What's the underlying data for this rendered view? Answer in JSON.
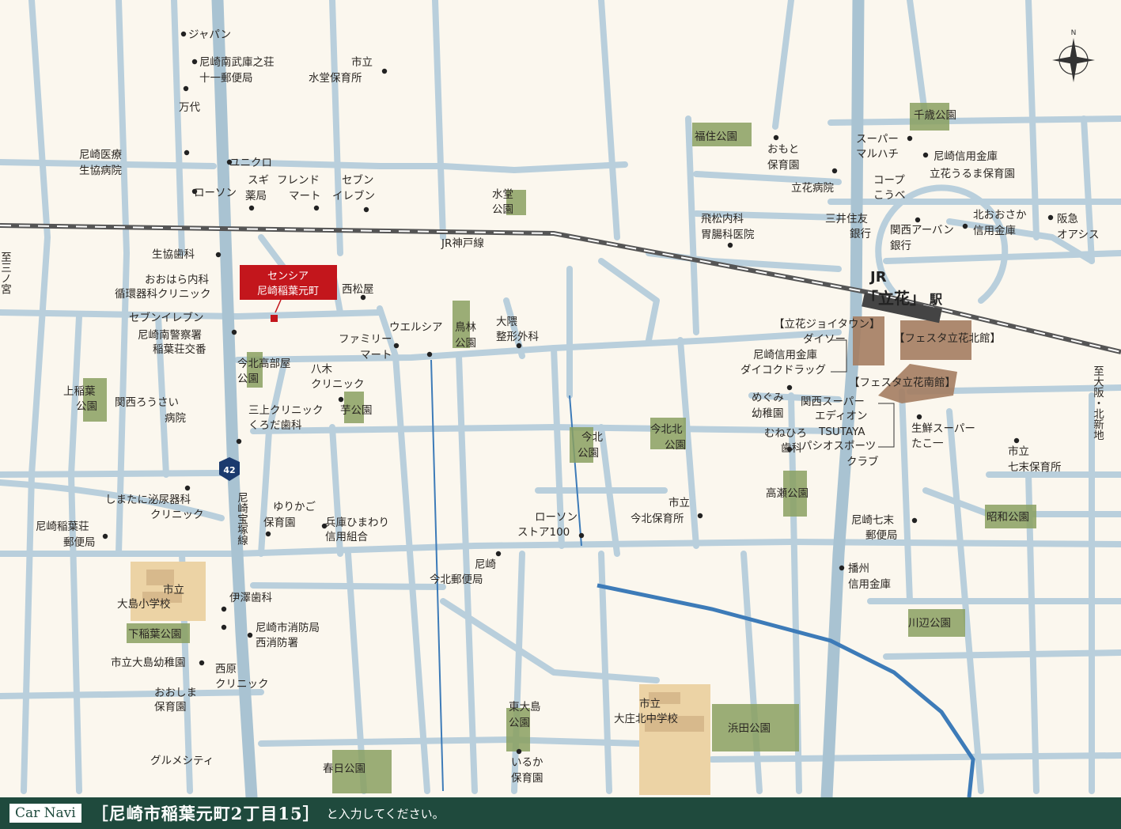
{
  "footer": {
    "carnavi": "Car Navi",
    "address": "［尼崎市稲葉元町2丁目15］",
    "instruction": "と入力してください。"
  },
  "property": {
    "line1": "センシア",
    "line2": "尼崎稲葉元町"
  },
  "station": {
    "jr": "JR",
    "name": "「立花」",
    "suffix": "駅"
  },
  "rail": {
    "line_name": "JR神戸線",
    "left_dest": "至三ノ宮",
    "right_dest": "至大阪・北新地"
  },
  "route": {
    "number": "42",
    "name": "尼崎宝塚線"
  },
  "compass": {
    "north": "N"
  },
  "colors": {
    "road": "#b9cfdc",
    "river": "#3d7bb8",
    "park": "#8aa060",
    "school": "#ecd3a5",
    "rail": "#555555",
    "property": "#c3161c",
    "footer": "#1f4a3d",
    "station": "#a57e62"
  },
  "facilities": [
    {
      "name": "ジャパン"
    },
    {
      "name": "尼崎南武庫之荘\n十一郵便局"
    },
    {
      "name": "市立\n水堂保育所"
    },
    {
      "name": "万代"
    },
    {
      "name": "尼崎医療\n生協病院"
    },
    {
      "name": "ユニクロ"
    },
    {
      "name": "スギ\n薬局"
    },
    {
      "name": "フレンド\nマート"
    },
    {
      "name": "セブン\nイレブン"
    },
    {
      "name": "ローソン"
    },
    {
      "name": "生協歯科"
    },
    {
      "name": "おおはら内科\n循環器科クリニック"
    },
    {
      "name": "セブンイレブン"
    },
    {
      "name": "尼崎南警察署\n稲葉荘交番"
    },
    {
      "name": "西松屋"
    },
    {
      "name": "ウエルシア"
    },
    {
      "name": "ファミリー\nマート"
    },
    {
      "name": "大隈\n整形外科"
    },
    {
      "name": "八木\nクリニック"
    },
    {
      "name": "三上クリニック\nくろだ歯科"
    },
    {
      "name": "関西ろうさい\n病院"
    },
    {
      "name": "しまたに泌尿器科\nクリニック"
    },
    {
      "name": "ゆりかご\n保育園"
    },
    {
      "name": "兵庫ひまわり\n信用組合"
    },
    {
      "name": "尼崎稲葉荘\n郵便局"
    },
    {
      "name": "ローソン\nストア100"
    },
    {
      "name": "尼崎\n今北郵便局"
    },
    {
      "name": "市立\n今北保育所"
    },
    {
      "name": "伊澤歯科"
    },
    {
      "name": "尼崎市消防局\n西消防署"
    },
    {
      "name": "市立大島幼稚園"
    },
    {
      "name": "西原\nクリニック"
    },
    {
      "name": "おおしま\n保育園"
    },
    {
      "name": "グルメシティ"
    },
    {
      "name": "いるか\n保育園"
    },
    {
      "name": "おもと\n保育園"
    },
    {
      "name": "立花病院"
    },
    {
      "name": "スーパー\nマルハチ"
    },
    {
      "name": "尼崎信用金庫"
    },
    {
      "name": "立花うるま保育園"
    },
    {
      "name": "コープ\nこうべ"
    },
    {
      "name": "飛松内科\n胃腸科医院"
    },
    {
      "name": "三井住友\n銀行"
    },
    {
      "name": "関西アーバン\n銀行"
    },
    {
      "name": "北おおさか\n信用金庫"
    },
    {
      "name": "阪急\nオアシス"
    },
    {
      "name": "めぐみ\n幼稚園"
    },
    {
      "name": "むねひろ\n歯科"
    },
    {
      "name": "生鮮スーパー\nたこ一"
    },
    {
      "name": "市立\n七末保育所"
    },
    {
      "name": "尼崎七末\n郵便局"
    },
    {
      "name": "播州\n信用金庫"
    }
  ],
  "parks": [
    {
      "name": "水堂\n公園"
    },
    {
      "name": "鳥林\n公園"
    },
    {
      "name": "今北高部屋\n公園"
    },
    {
      "name": "芋公園"
    },
    {
      "name": "上稲葉\n公園"
    },
    {
      "name": "今北\n公園"
    },
    {
      "name": "今北北\n公園"
    },
    {
      "name": "下稲葉公園"
    },
    {
      "name": "東大島\n公園"
    },
    {
      "name": "春日公園"
    },
    {
      "name": "浜田公園"
    },
    {
      "name": "高瀬公園"
    },
    {
      "name": "福住公園"
    },
    {
      "name": "千歳公園"
    },
    {
      "name": "昭和公園"
    },
    {
      "name": "川辺公園"
    }
  ],
  "schools": [
    {
      "name": "市立\n大島小学校"
    },
    {
      "name": "市立\n大庄北中学校"
    }
  ],
  "malls": {
    "joy_town": "【立花ジョイタウン】",
    "joy_tenants": [
      "ダイソー",
      "尼崎信用金庫",
      "ダイコクドラッグ"
    ],
    "festa_north": "【フェスタ立花北館】",
    "festa_south": "【フェスタ立花南館】",
    "festa_tenants": [
      "関西スーパー",
      "エディオン",
      "TSUTAYA",
      "パシオスポーツ\nクラブ"
    ]
  }
}
